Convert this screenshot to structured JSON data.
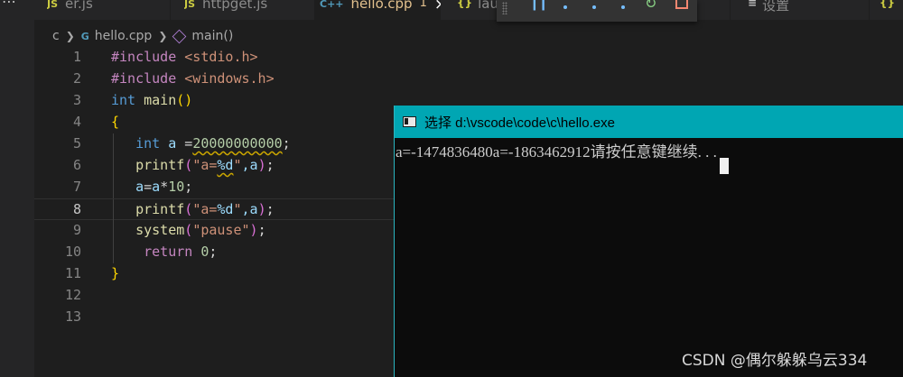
{
  "tabs": [
    {
      "label": "er.js",
      "icon": "JS"
    },
    {
      "label": "httpget.js",
      "icon": "JS"
    },
    {
      "label": "hello.cpp",
      "icon": "C++",
      "modified_marker": "1"
    },
    {
      "label": "lau",
      "icon": "{}"
    },
    {
      "label": "设置",
      "icon": "≡"
    },
    {
      "label": "",
      "icon": "{}"
    }
  ],
  "breadcrumb": {
    "folder": "c",
    "file": "hello.cpp",
    "symbol": "main()"
  },
  "code_lines": [
    {
      "num": "1"
    },
    {
      "num": "2"
    },
    {
      "num": "3"
    },
    {
      "num": "4"
    },
    {
      "num": "5"
    },
    {
      "num": "6"
    },
    {
      "num": "7"
    },
    {
      "num": "8"
    },
    {
      "num": "9"
    },
    {
      "num": "10"
    },
    {
      "num": "11"
    },
    {
      "num": "12"
    },
    {
      "num": "13"
    }
  ],
  "code_tokens": {
    "l1_pp": "#include",
    "l1_inc": "<stdio.h>",
    "l2_pp": "#include",
    "l2_inc": "<windows.h>",
    "l3_kw": "int",
    "l3_fn": "main",
    "l3_open": "(",
    "l3_close": ")",
    "l4": "{",
    "l5_kw": "int",
    "l5_var": "a",
    "l5_eq": "=",
    "l5_num": "20000000000",
    "l5_semi": ";",
    "l6_fn": "printf",
    "l6_open": "(",
    "l6_str1": "\"a=",
    "l6_esc": "%d",
    "l6_str2": "\"",
    "l6_rest": ",a",
    "l6_close": ")",
    "l6_semi": ";",
    "l7_var1": "a",
    "l7_eq": "=",
    "l7_var2": "a",
    "l7_op": "*",
    "l7_num": "10",
    "l7_semi": ";",
    "l8_fn": "printf",
    "l8_open": "(",
    "l8_str1": "\"a=",
    "l8_esc": "%d",
    "l8_str2": "\"",
    "l8_rest": ",a",
    "l8_close": ")",
    "l8_semi": ";",
    "l9_fn": "system",
    "l9_open": "(",
    "l9_str": "\"pause\"",
    "l9_close": ")",
    "l9_semi": ";",
    "l10_kw": "return",
    "l10_num": "0",
    "l10_semi": ";",
    "l11": "}"
  },
  "console": {
    "title": "选择 d:\\vscode\\code\\c\\hello.exe",
    "output": "a=-1474836480a=-1863462912请按任意键继续. . .",
    "watermark": "CSDN @偶尔躲躲乌云334"
  },
  "colors": {
    "accent": "#00a6b3",
    "keyword": "#569cd6",
    "string": "#ce9178",
    "function": "#dcdcaa"
  }
}
